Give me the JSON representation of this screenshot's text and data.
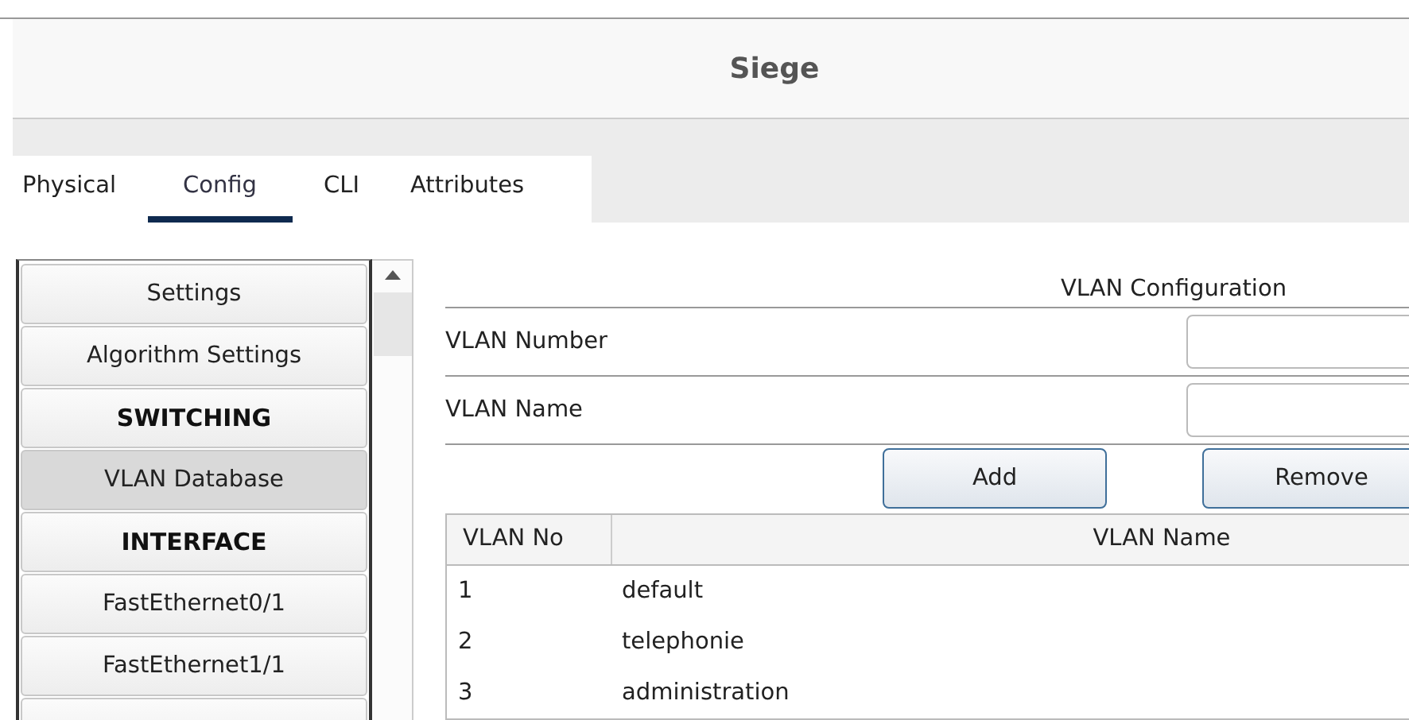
{
  "window": {
    "title": "Siege"
  },
  "tabs": [
    {
      "label": "Physical",
      "selected": false
    },
    {
      "label": "Config",
      "selected": true
    },
    {
      "label": "CLI",
      "selected": false
    },
    {
      "label": "Attributes",
      "selected": false
    }
  ],
  "sidebar": {
    "items": [
      {
        "kind": "button",
        "label": "Settings",
        "selected": false
      },
      {
        "kind": "button",
        "label": "Algorithm Settings",
        "selected": false
      },
      {
        "kind": "header",
        "label": "SWITCHING"
      },
      {
        "kind": "button",
        "label": "VLAN Database",
        "selected": true
      },
      {
        "kind": "header",
        "label": "INTERFACE"
      },
      {
        "kind": "button",
        "label": "FastEthernet0/1",
        "selected": false
      },
      {
        "kind": "button",
        "label": "FastEthernet1/1",
        "selected": false
      }
    ]
  },
  "vlan_config": {
    "title": "VLAN Configuration",
    "fields": [
      {
        "label": "VLAN Number"
      },
      {
        "label": "VLAN Name"
      }
    ],
    "buttons": [
      "Add",
      "Remove"
    ],
    "table": {
      "columns": [
        "VLAN No",
        "VLAN Name"
      ],
      "rows": [
        [
          "1",
          "default"
        ],
        [
          "2",
          "telephonie"
        ],
        [
          "3",
          "administration"
        ]
      ]
    }
  }
}
